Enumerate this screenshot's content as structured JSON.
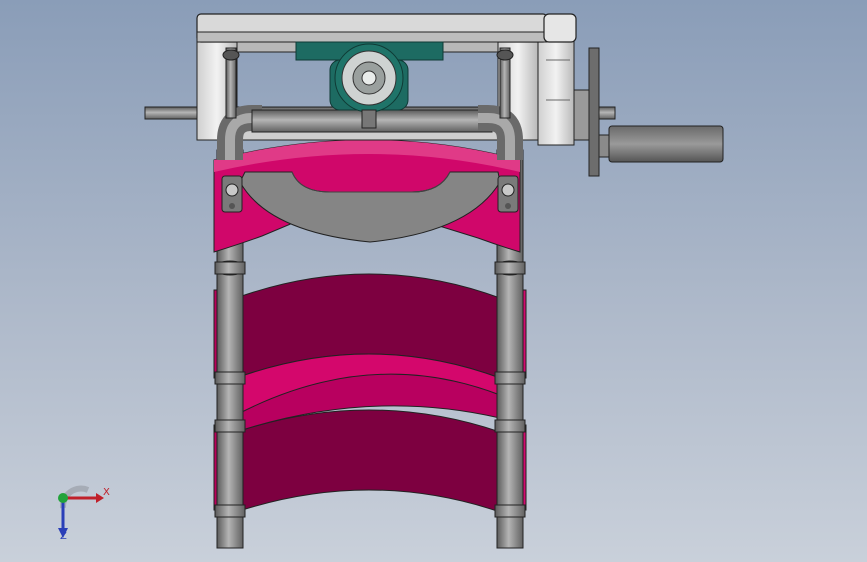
{
  "triad": {
    "x_label": "X",
    "z_label": "Z",
    "colors": {
      "x": "#c0202a",
      "y": "#22a33a",
      "z": "#2a3fb8"
    }
  },
  "model_colors": {
    "frame_gray": "#8c8c8c",
    "band_magenta": "#d0076a",
    "band_dark": "#7d0040",
    "motor_teal": "#1d6b62",
    "background_top": "#8a9db8",
    "background_bottom": "#c9d0da"
  }
}
